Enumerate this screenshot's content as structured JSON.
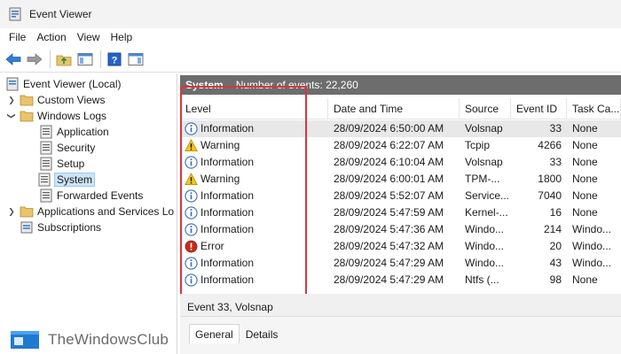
{
  "window": {
    "title": "Event Viewer"
  },
  "menu": [
    "File",
    "Action",
    "View",
    "Help"
  ],
  "toolbar": {
    "buttons": [
      "back-icon",
      "forward-icon",
      "up-folder-icon",
      "show-hide-tree-icon",
      "help-icon",
      "show-hide-action-pane-icon"
    ]
  },
  "tree": {
    "root": "Event Viewer (Local)",
    "custom_views": "Custom Views",
    "windows_logs": "Windows Logs",
    "application": "Application",
    "security": "Security",
    "setup": "Setup",
    "system": "System",
    "forwarded": "Forwarded Events",
    "apps_services": "Applications and Services Lo",
    "subscriptions": "Subscriptions"
  },
  "pane": {
    "title": "System",
    "count": "Number of events: 22,260"
  },
  "columns": {
    "level": "Level",
    "date": "Date and Time",
    "source": "Source",
    "event_id": "Event ID",
    "task": "Task Ca..."
  },
  "events": [
    {
      "level": "Information",
      "type": "info",
      "date": "28/09/2024 6:50:00 AM",
      "source": "Volsnap",
      "id": "33",
      "task": "None"
    },
    {
      "level": "Warning",
      "type": "warn",
      "date": "28/09/2024 6:22:07 AM",
      "source": "Tcpip",
      "id": "4266",
      "task": "None"
    },
    {
      "level": "Information",
      "type": "info",
      "date": "28/09/2024 6:10:04 AM",
      "source": "Volsnap",
      "id": "33",
      "task": "None"
    },
    {
      "level": "Warning",
      "type": "warn",
      "date": "28/09/2024 6:00:01 AM",
      "source": "TPM-...",
      "id": "1800",
      "task": "None"
    },
    {
      "level": "Information",
      "type": "info",
      "date": "28/09/2024 5:52:07 AM",
      "source": "Service...",
      "id": "7040",
      "task": "None"
    },
    {
      "level": "Information",
      "type": "info",
      "date": "28/09/2024 5:47:59 AM",
      "source": "Kernel-...",
      "id": "16",
      "task": "None"
    },
    {
      "level": "Information",
      "type": "info",
      "date": "28/09/2024 5:47:36 AM",
      "source": "Windo...",
      "id": "214",
      "task": "Windo..."
    },
    {
      "level": "Error",
      "type": "error",
      "date": "28/09/2024 5:47:32 AM",
      "source": "Windo...",
      "id": "20",
      "task": "Windo..."
    },
    {
      "level": "Information",
      "type": "info",
      "date": "28/09/2024 5:47:29 AM",
      "source": "Windo...",
      "id": "43",
      "task": "Windo..."
    },
    {
      "level": "Information",
      "type": "info",
      "date": "28/09/2024 5:47:29 AM",
      "source": "Ntfs (...",
      "id": "98",
      "task": "None"
    }
  ],
  "details": {
    "title": "Event 33, Volsnap",
    "tab_general": "General",
    "tab_details": "Details"
  },
  "watermark": {
    "text": "TheWindowsClub"
  },
  "colors": {
    "highlight": "#d9363e",
    "header_bg": "#6d6d6d",
    "selection": "#cce4f7"
  }
}
